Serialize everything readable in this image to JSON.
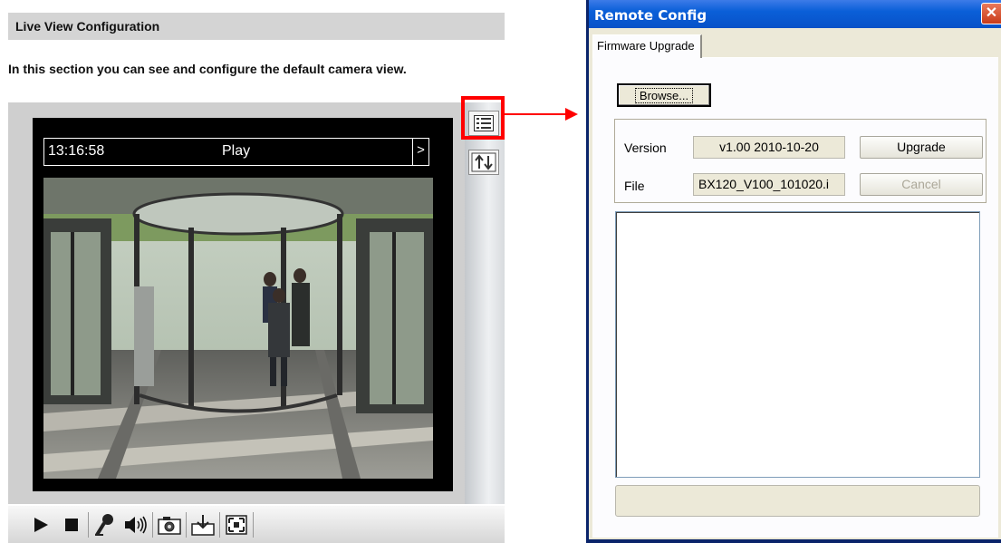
{
  "left": {
    "header_title": "Live View Configuration",
    "description": "In this section you can see and configure the default camera view.",
    "overlay": {
      "time": "13:16:58",
      "status": "Play",
      "next_glyph": ">"
    },
    "side_icons": [
      "list-icon",
      "swap-arrows-icon"
    ],
    "controls": [
      "play-icon",
      "stop-icon",
      "microphone-icon",
      "speaker-icon",
      "snapshot-camera-icon",
      "save-download-icon",
      "fullscreen-icon"
    ]
  },
  "dialog": {
    "title": "Remote Config",
    "close_glyph": "✕",
    "tab": "Firmware Upgrade",
    "browse_label": "Browse...",
    "version_label": "Version",
    "version_value": "v1.00 2010-10-20",
    "upgrade_label": "Upgrade",
    "file_label": "File",
    "file_value": "BX120_V100_101020.i",
    "cancel_label": "Cancel"
  },
  "colors": {
    "highlight": "#ff0000",
    "titlebar": "#0a5fd8",
    "dialog_bg": "#ece9d8"
  }
}
